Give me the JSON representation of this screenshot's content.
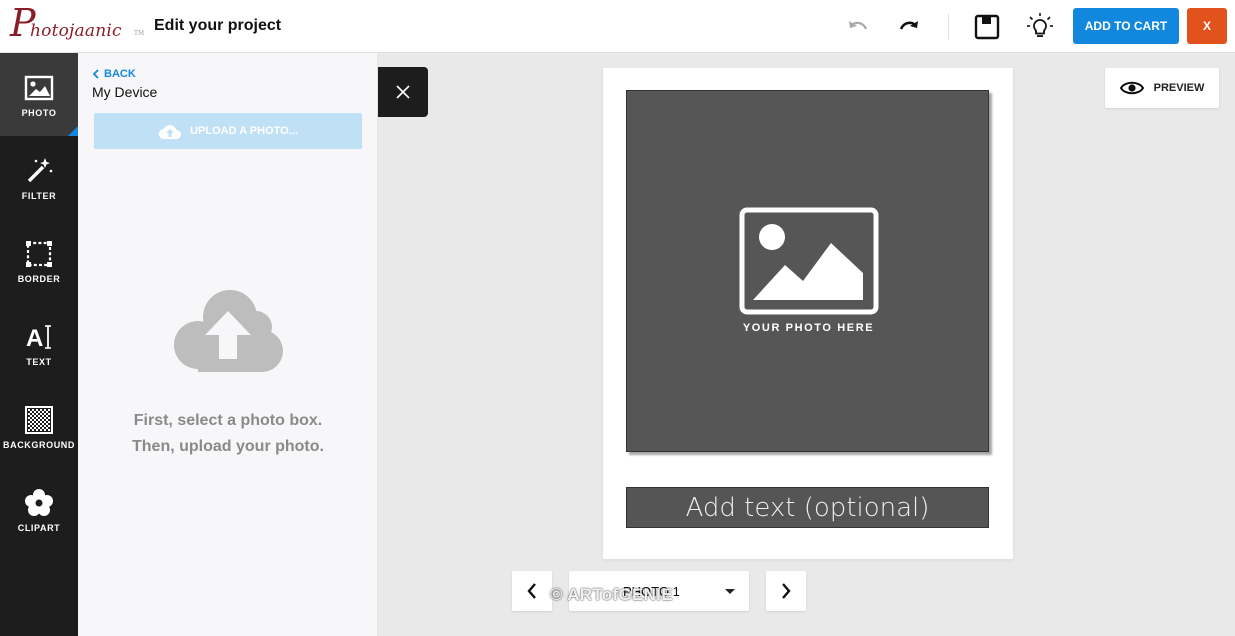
{
  "header": {
    "logo_big_letter": "P",
    "logo_rest": "hotojaanic",
    "logo_tm": "TM",
    "title": "Edit your project",
    "add_to_cart": "ADD TO CART",
    "close": "X"
  },
  "icons": {
    "undo": "undo-icon",
    "redo": "redo-icon",
    "save": "save-icon",
    "tips": "lightbulb-icon"
  },
  "rail": {
    "items": [
      {
        "label": "PHOTO",
        "icon": "photo-icon",
        "active": true
      },
      {
        "label": "FILTER",
        "icon": "magic-wand-icon",
        "active": false
      },
      {
        "label": "BORDER",
        "icon": "border-icon",
        "active": false
      },
      {
        "label": "TEXT",
        "icon": "text-icon",
        "active": false
      },
      {
        "label": "BACKGROUND",
        "icon": "background-icon",
        "active": false
      },
      {
        "label": "CLIPART",
        "icon": "flower-icon",
        "active": false
      }
    ]
  },
  "panel": {
    "back": "BACK",
    "title": "My Device",
    "upload_button": "UPLOAD A PHOTO...",
    "instruction_line1": "First, select a photo box.",
    "instruction_line2": "Then, upload your photo."
  },
  "canvas": {
    "preview": "PREVIEW",
    "photo_placeholder": "YOUR PHOTO HERE",
    "text_placeholder": "Add text (optional)"
  },
  "pager": {
    "selected": "PHOTO 1"
  },
  "watermark": "© ARTofGENIE",
  "colors": {
    "accent_blue": "#1188dd",
    "close_orange": "#e2521d",
    "rail_bg": "#1d1d1d",
    "logo_red": "#8a1d26"
  }
}
